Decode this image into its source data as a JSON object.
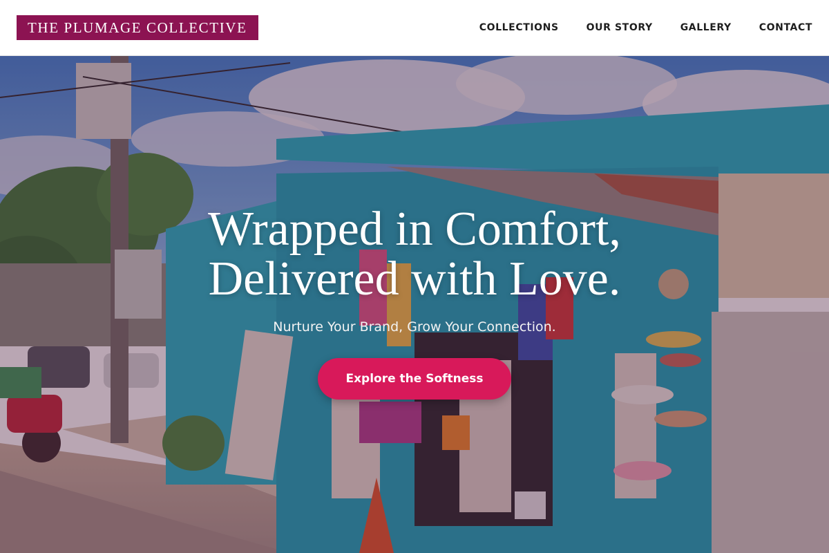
{
  "brand": {
    "name": "THE PLUMAGE COLLECTIVE",
    "color": "#8c1352"
  },
  "nav": {
    "items": [
      {
        "label": "COLLECTIONS"
      },
      {
        "label": "OUR STORY"
      },
      {
        "label": "GALLERY"
      },
      {
        "label": "CONTACT"
      }
    ]
  },
  "hero": {
    "title_line1": "Wrapped in Comfort,",
    "title_line2": "Delivered with Love.",
    "subtitle": "Nurture Your Brand, Grow Your Connection.",
    "cta_label": "Explore the Softness",
    "cta_color": "#d8195a",
    "background_image": "colorful roadside souvenir shop with hats and bright textiles"
  }
}
